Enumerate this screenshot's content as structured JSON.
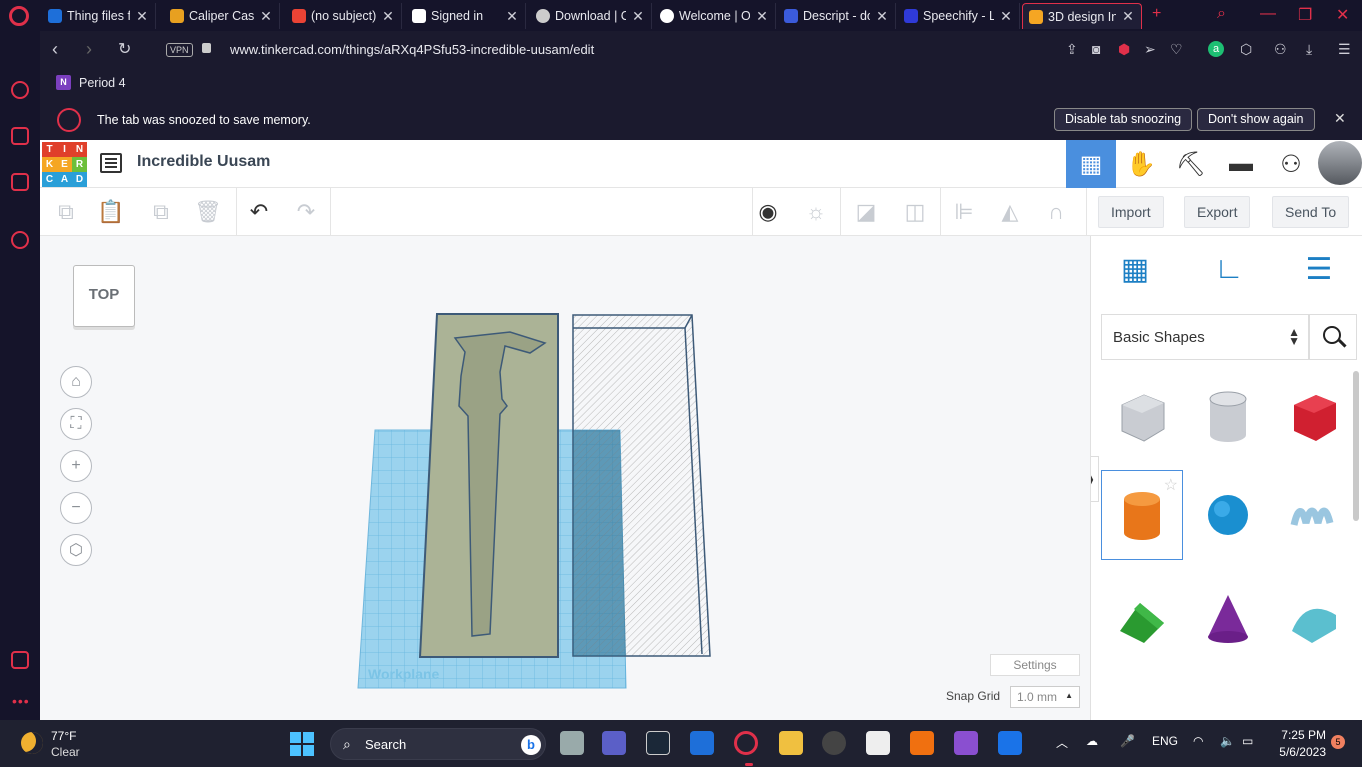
{
  "browser": {
    "tabs": [
      {
        "title": "Thing files fo",
        "favicon_color": "#1e6fd9"
      },
      {
        "title": "Caliper Case",
        "favicon_color": "#e8a020"
      },
      {
        "title": "(no subject)",
        "favicon_color": "#ea4335"
      },
      {
        "title": "Signed in",
        "favicon_color": "#ffffff"
      },
      {
        "title": "Download | C",
        "favicon_color": "#cccccc"
      },
      {
        "title": "Welcome | O",
        "favicon_color": "#ffffff"
      },
      {
        "title": "Descript - do",
        "favicon_color": "#3b5bdb"
      },
      {
        "title": "Speechify - L",
        "favicon_color": "#2f3ad8"
      },
      {
        "title": "3D design In",
        "favicon_color": "#f5a623"
      }
    ],
    "url": "www.tinkercad.com/things/aRXq4PSfu53-incredible-uusam/edit",
    "vpn_label": "VPN",
    "bookmark": "Period 4",
    "snooze": {
      "message": "The tab was snoozed to save memory.",
      "disable_label": "Disable tab snoozing",
      "dont_show_label": "Don't show again"
    }
  },
  "tinkercad": {
    "logo_letters": [
      "T",
      "I",
      "N",
      "K",
      "E",
      "R",
      "C",
      "A",
      "D"
    ],
    "logo_colors": [
      "#e0402a",
      "#e0402a",
      "#e0402a",
      "#f5a623",
      "#f5a623",
      "#6cbf3a",
      "#2a9fd8",
      "#2a9fd8",
      "#2a9fd8"
    ],
    "design_title": "Incredible Uusam",
    "import_label": "Import",
    "export_label": "Export",
    "sendto_label": "Send To",
    "viewcube_label": "TOP",
    "workplane_label": "Workplane",
    "settings_label": "Settings",
    "snap_grid_label": "Snap Grid",
    "snap_grid_value": "1.0 mm",
    "shape_library": "Basic Shapes",
    "accent_color": "#4a8fde"
  },
  "taskbar": {
    "temperature": "77°F",
    "condition": "Clear",
    "search_label": "Search",
    "language": "ENG",
    "time": "7:25 PM",
    "date": "5/6/2023",
    "notification_count": "5"
  }
}
